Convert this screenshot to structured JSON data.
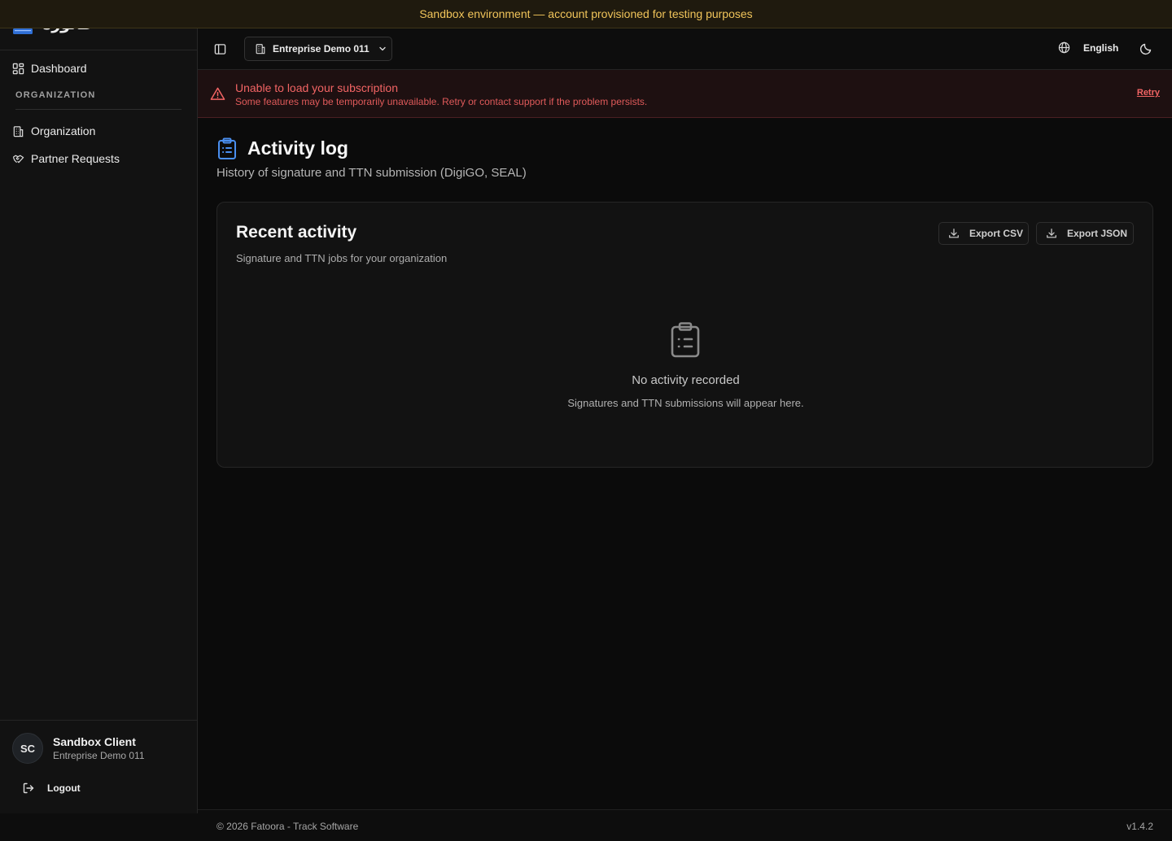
{
  "banner": {
    "text": "Sandbox environment — account provisioned for testing purposes"
  },
  "brand": {
    "name": "فاتورة"
  },
  "sidebar": {
    "items": [
      {
        "label": "Dashboard",
        "icon": "dashboard-grid-icon"
      },
      {
        "label": "Organization",
        "icon": "building-icon"
      },
      {
        "label": "Partner Requests",
        "icon": "handshake-icon"
      }
    ],
    "section_label": "ORGANIZATION"
  },
  "user": {
    "initials": "SC",
    "name": "Sandbox Client",
    "org": "Entreprise Demo 011",
    "logout_label": "Logout"
  },
  "topbar": {
    "org_name": "Entreprise Demo 011",
    "language": "English"
  },
  "alert": {
    "title": "Unable to load your subscription",
    "text": "Some features may be temporarily unavailable. Retry or contact support if the problem persists.",
    "retry_label": "Retry"
  },
  "page": {
    "title": "Activity log",
    "subtitle": "History of signature and TTN submission (DigiGO, SEAL)"
  },
  "card": {
    "title": "Recent activity",
    "subtitle": "Signature and TTN jobs for your organization",
    "export_csv_label": "Export CSV",
    "export_json_label": "Export JSON",
    "empty_title": "No activity recorded",
    "empty_text": "Signatures and TTN submissions will appear here."
  },
  "footer": {
    "copyright": "© 2026 Fatoora - Track Software",
    "version": "v1.4.2"
  },
  "colors": {
    "accent": "#3b82f6",
    "warning": "#f0c45a",
    "danger": "#f26464",
    "background": "#0b0b0b"
  }
}
